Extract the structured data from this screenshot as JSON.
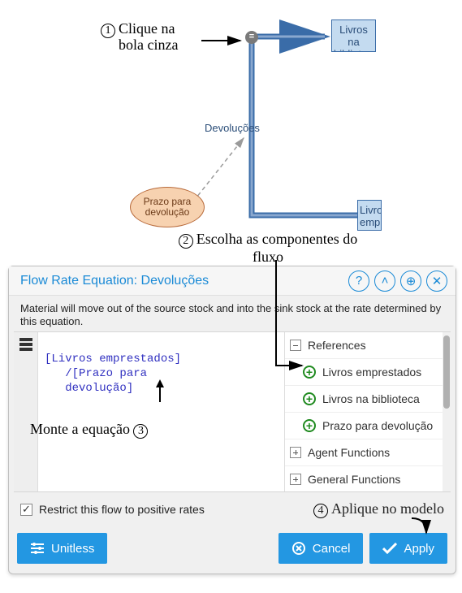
{
  "annotations": {
    "step1": "Clique na bola cinza",
    "step2": "Escolha as componentes do fluxo",
    "step3": "Monte a equação",
    "step4": "Aplique no modelo",
    "num1": "1",
    "num2": "2",
    "num3": "3",
    "num4": "4"
  },
  "diagram": {
    "stock1": "Livros na biblioteca",
    "stock2": "Livros emprestados",
    "param": "Prazo para devolução",
    "flow_label": "Devoluções",
    "dot_glyph": "="
  },
  "dialog": {
    "title": "Flow Rate Equation: Devoluções",
    "description": "Material will move out of the source stock and into the sink stock at the rate determined by this equation.",
    "equation_line1": "[Livros emprestados]",
    "equation_line2": "/[Prazo para",
    "equation_line3": "devolução]",
    "refs_header": "References",
    "refs": {
      "r1": "Livros emprestados",
      "r2": "Livros na biblioteca",
      "r3": "Prazo para devolução"
    },
    "group_agent": "Agent Functions",
    "group_general": "General Functions",
    "restrict_label": "Restrict this flow to positive rates",
    "restrict_checked": "✓",
    "btn_unitless": "Unitless",
    "btn_cancel": "Cancel",
    "btn_apply": "Apply"
  },
  "icons": {
    "help": "?",
    "up": "˄",
    "move": "⊕",
    "close": "✕",
    "cancel_x": "✖",
    "apply_check": "✔",
    "sliders": "≡"
  }
}
